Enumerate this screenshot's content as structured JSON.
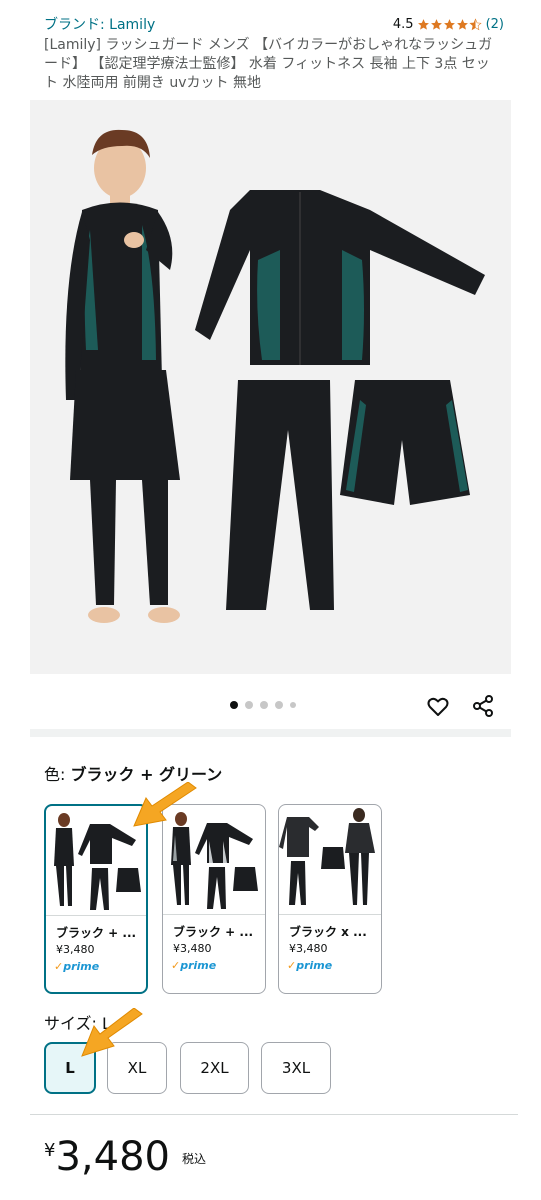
{
  "header": {
    "brand": "ブランド: Lamily",
    "rating_value": "4.5",
    "rating_stars": 4.5,
    "review_count": "(2)",
    "title": "[Lamily] ラッシュガード メンズ 【バイカラーがおしゃれなラッシュガード】 【認定理学療法士監修】 水着 フィットネス 長袖 上下 3点 セット 水陸両用 前開き uvカット 無地"
  },
  "gallery": {
    "image_count": 5,
    "active_index": 0
  },
  "color": {
    "label": "色:",
    "value": "ブラック + グリーン",
    "options": [
      {
        "name": "ブラック + ...",
        "price": "¥3,480",
        "prime": "prime",
        "selected": true
      },
      {
        "name": "ブラック + ...",
        "price": "¥3,480",
        "prime": "prime",
        "selected": false
      },
      {
        "name": "ブラック x ...",
        "price": "¥3,480",
        "prime": "prime",
        "selected": false
      }
    ]
  },
  "size": {
    "label": "サイズ: L",
    "options": [
      "L",
      "XL",
      "2XL",
      "3XL"
    ],
    "selected": "L"
  },
  "price": {
    "currency": "¥",
    "amount": "3,480",
    "tax": "税込"
  },
  "colors": {
    "link": "#007185",
    "star": "#de7921",
    "accent_arrow": "#f5a623",
    "selected_border": "#007185"
  }
}
